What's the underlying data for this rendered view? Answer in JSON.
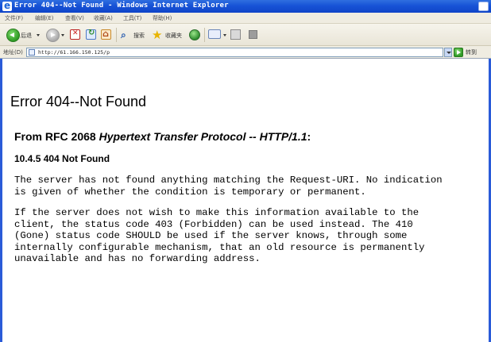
{
  "window": {
    "title": "Error 404--Not Found - Windows Internet Explorer"
  },
  "menu": {
    "items": [
      "文件(F)",
      "编辑(E)",
      "查看(V)",
      "收藏(A)",
      "工具(T)",
      "帮助(H)"
    ]
  },
  "toolbar": {
    "back_label": "后退",
    "search_label": "搜索",
    "favorites_label": "收藏夹"
  },
  "address_bar": {
    "label": "地址(D)",
    "url": "http://61.166.150.125/p",
    "go_label": "转到"
  },
  "page": {
    "title": "Error 404--Not Found",
    "rfc_prefix": "From RFC 2068 ",
    "rfc_title": "Hypertext Transfer Protocol -- HTTP/1.1",
    "rfc_suffix": ":",
    "section_heading": "10.4.5 404 Not Found",
    "paragraph1_lines": [
      "The server has not found anything matching the Request-URI. No indication",
      "is given of whether the condition is temporary or permanent."
    ],
    "paragraph2_lines": [
      "If the server does not wish to make this information available to the",
      "client, the status code 403 (Forbidden) can be used instead. The 410",
      "(Gone) status code SHOULD be used if the server knows, through some",
      "internally configurable mechanism, that an old resource is permanently",
      "unavailable and has no forwarding address."
    ]
  }
}
